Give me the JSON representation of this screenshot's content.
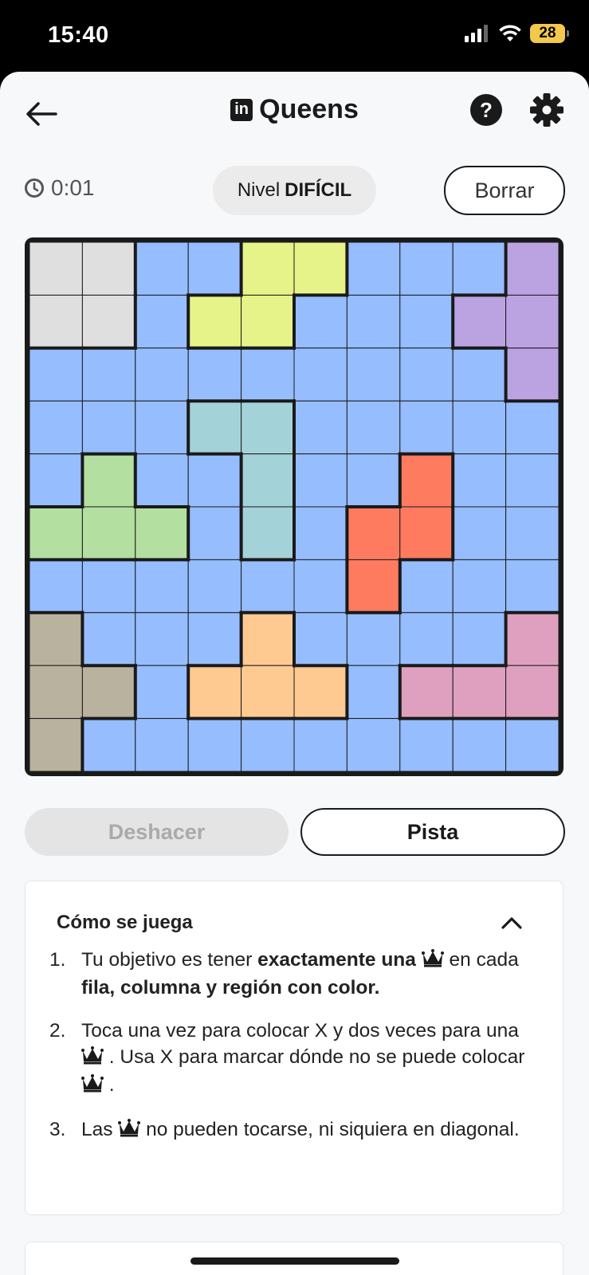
{
  "status_bar": {
    "time": "15:40",
    "battery": "28"
  },
  "header": {
    "title": "Queens",
    "logo_text": "in",
    "help_label": "?"
  },
  "game": {
    "timer": "0:01",
    "level_label": "Nivel",
    "level_value": "DIFÍCIL",
    "clear_label": "Borrar",
    "undo_label": "Deshacer",
    "hint_label": "Pista"
  },
  "board": {
    "size": 10,
    "region_colors": {
      "gray": "#dfdfdf",
      "blue": "#96bdfe",
      "yellow": "#e6f388",
      "purple": "#bba3e2",
      "teal": "#a3d2d8",
      "green": "#b3dfa0",
      "red": "#ff7b60",
      "tan": "#b9b29e",
      "orange": "#ffc992",
      "pink": "#dfa0bf"
    },
    "grid": [
      [
        "gray",
        "gray",
        "blue",
        "blue",
        "yellow",
        "yellow",
        "blue",
        "blue",
        "blue",
        "purple"
      ],
      [
        "gray",
        "gray",
        "blue",
        "yellow",
        "yellow",
        "blue",
        "blue",
        "blue",
        "purple",
        "purple"
      ],
      [
        "blue",
        "blue",
        "blue",
        "blue",
        "blue",
        "blue",
        "blue",
        "blue",
        "blue",
        "purple"
      ],
      [
        "blue",
        "blue",
        "blue",
        "teal",
        "teal",
        "blue",
        "blue",
        "blue",
        "blue",
        "blue"
      ],
      [
        "blue",
        "green",
        "blue",
        "blue",
        "teal",
        "blue",
        "blue",
        "red",
        "blue",
        "blue"
      ],
      [
        "green",
        "green",
        "green",
        "blue",
        "teal",
        "blue",
        "red",
        "red",
        "blue",
        "blue"
      ],
      [
        "blue",
        "blue",
        "blue",
        "blue",
        "blue",
        "blue",
        "red",
        "blue",
        "blue",
        "blue"
      ],
      [
        "tan",
        "blue",
        "blue",
        "blue",
        "orange",
        "blue",
        "blue",
        "blue",
        "blue",
        "pink"
      ],
      [
        "tan",
        "tan",
        "blue",
        "orange",
        "orange",
        "orange",
        "blue",
        "pink",
        "pink",
        "pink"
      ],
      [
        "tan",
        "blue",
        "blue",
        "blue",
        "blue",
        "blue",
        "blue",
        "blue",
        "blue",
        "blue"
      ]
    ]
  },
  "how_to_play": {
    "title": "Cómo se juega",
    "steps": [
      {
        "num": "1.",
        "a": "Tu objetivo es tener ",
        "b": "exactamente una",
        "c": " en cada ",
        "d": "fila, columna y región con color."
      },
      {
        "num": "2.",
        "a": "Toca una vez para colocar X y dos veces para una ",
        "b": " . Usa X para marcar dónde no se puede colocar ",
        "c": " ."
      },
      {
        "num": "3.",
        "a": "Las ",
        "b": " no pueden tocarse, ni siquiera en diagonal."
      }
    ]
  },
  "icons": {
    "back": "arrow-left-icon",
    "help": "question-circle-icon",
    "settings": "gear-icon",
    "timer": "clock-icon",
    "collapse": "chevron-up-icon",
    "queen": "crown-icon"
  }
}
